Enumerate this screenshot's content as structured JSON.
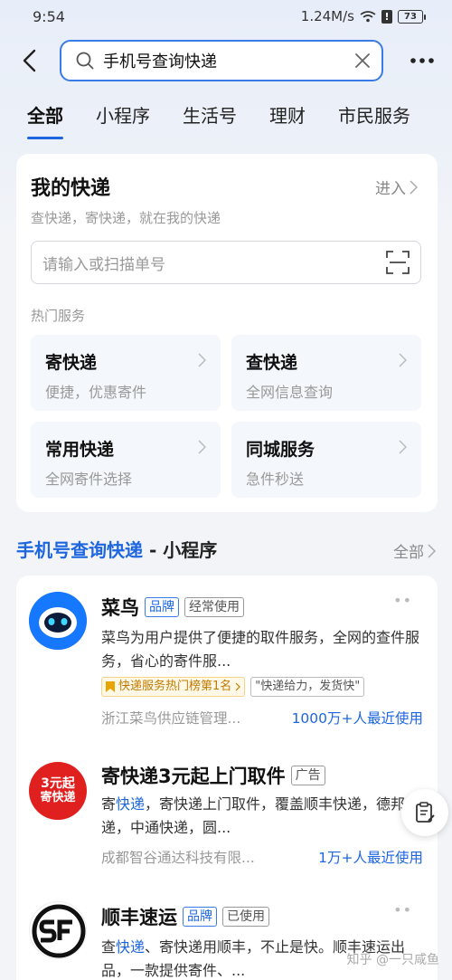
{
  "status_bar": {
    "time": "9:54",
    "network_speed": "1.24M/s",
    "battery": "73"
  },
  "search": {
    "query": "手机号查询快递"
  },
  "tabs": [
    {
      "label": "全部",
      "active": true
    },
    {
      "label": "小程序"
    },
    {
      "label": "生活号"
    },
    {
      "label": "理财"
    },
    {
      "label": "市民服务"
    }
  ],
  "my_express": {
    "title": "我的快递",
    "enter_label": "进入",
    "subtitle": "查快递，寄快递，就在我的快递",
    "input_placeholder": "请输入或扫描单号",
    "hot_label": "热门服务",
    "services": [
      {
        "name": "寄快递",
        "desc": "便捷，优惠寄件"
      },
      {
        "name": "查快递",
        "desc": "全网信息查询"
      },
      {
        "name": "常用快递",
        "desc": "全网寄件选择"
      },
      {
        "name": "同城服务",
        "desc": "急件秒送"
      }
    ]
  },
  "section": {
    "highlight": "手机号查询快递",
    "suffix": " - 小程序",
    "all_label": "全部"
  },
  "mini_programs": [
    {
      "name": "菜鸟",
      "tags": [
        "品牌",
        "经常使用"
      ],
      "desc": "菜鸟为用户提供了便捷的取件服务，全网的查件服务，省心的寄件服...",
      "rank_badge": "快递服务热门榜第1名",
      "quote_badge": "\"快递给力，发货快\"",
      "corp": "浙江菜鸟供应链管理...",
      "users": "1000万+人最近使用"
    },
    {
      "name": "寄快递3元起上门取件",
      "tags": [
        "广告"
      ],
      "logo_text_1": "3元起",
      "logo_text_2": "寄快递",
      "desc_pre": "寄",
      "desc_hl": "快递",
      "desc_post": "，寄快递上门取件，覆盖顺丰快递，德邦快递，中通快递，圆...",
      "corp": "成都智谷通达科技有限...",
      "users": "1万+人最近使用"
    },
    {
      "name": "顺丰速运",
      "tags": [
        "品牌",
        "已使用"
      ],
      "desc_pre": "查",
      "desc_hl": "快递",
      "desc_post": "、寄快递用顺丰，不止是快。顺丰速运出品，一款提供寄件、..."
    }
  ],
  "watermark": "知乎 @一只咸鱼"
}
